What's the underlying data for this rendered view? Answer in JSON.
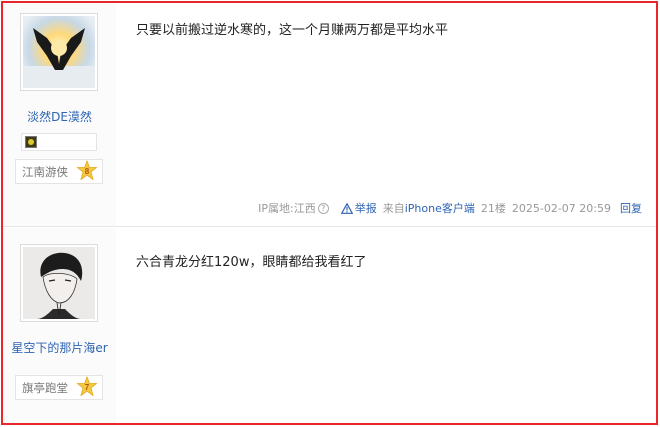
{
  "posts": [
    {
      "username": "淡然DE漠然",
      "rank_title": "江南游侠",
      "level": "8",
      "content": "只要以前搬过逆水寒的，这一个月赚两万都是平均水平",
      "ip_label": "IP属地:江西",
      "report": "举报",
      "source_prefix": "来自",
      "source_client": "iPhone客户端",
      "floor": "21楼",
      "datetime": "2025-02-07 20:59",
      "reply": "回复"
    },
    {
      "username": "星空下的那片海er",
      "rank_title": "旗亭跑堂",
      "level": "7",
      "content": "六合青龙分红120w，眼睛都给我看红了"
    }
  ],
  "colors": {
    "frame": "#e8262b",
    "link": "#2d64b3",
    "star": "#f3c843"
  }
}
